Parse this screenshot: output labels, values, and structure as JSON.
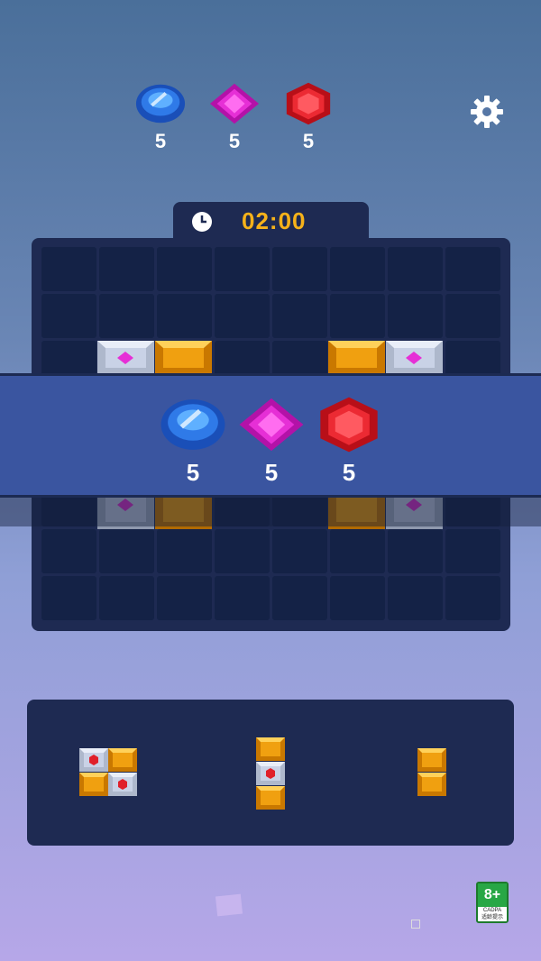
{
  "goals": [
    {
      "gem": "blue-gem",
      "count": "5",
      "color": "#1f63d6"
    },
    {
      "gem": "pink-gem",
      "count": "5",
      "color": "#e01fcf"
    },
    {
      "gem": "red-gem",
      "count": "5",
      "color": "#e0202a"
    }
  ],
  "settings": {
    "icon": "gear-icon"
  },
  "timer": {
    "icon": "clock-icon",
    "time": "02:00"
  },
  "banner_goals": [
    {
      "gem": "blue-gem",
      "count": "5"
    },
    {
      "gem": "pink-gem",
      "count": "5"
    },
    {
      "gem": "red-gem",
      "count": "5"
    }
  ],
  "board": {
    "cols": 8,
    "rows": 8
  },
  "age_rating": {
    "age": "8+",
    "org": "CADPA",
    "note": "适龄提示"
  },
  "colors": {
    "orange_block": "#f0a010",
    "silver_block": "#c9d2e6",
    "board": "#1e2a52"
  }
}
